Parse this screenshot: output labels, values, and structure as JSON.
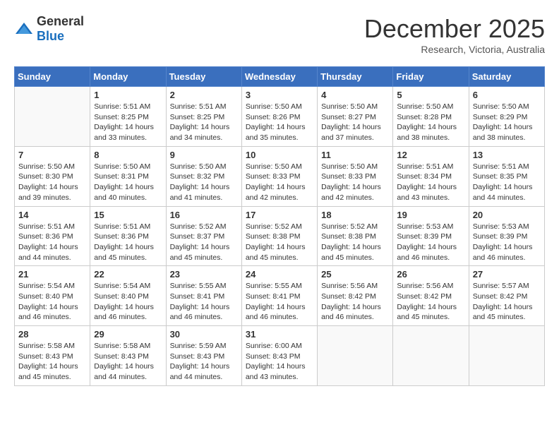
{
  "header": {
    "logo_general": "General",
    "logo_blue": "Blue",
    "month_title": "December 2025",
    "subtitle": "Research, Victoria, Australia"
  },
  "weekdays": [
    "Sunday",
    "Monday",
    "Tuesday",
    "Wednesday",
    "Thursday",
    "Friday",
    "Saturday"
  ],
  "weeks": [
    [
      {
        "day": "",
        "info": ""
      },
      {
        "day": "1",
        "info": "Sunrise: 5:51 AM\nSunset: 8:25 PM\nDaylight: 14 hours\nand 33 minutes."
      },
      {
        "day": "2",
        "info": "Sunrise: 5:51 AM\nSunset: 8:25 PM\nDaylight: 14 hours\nand 34 minutes."
      },
      {
        "day": "3",
        "info": "Sunrise: 5:50 AM\nSunset: 8:26 PM\nDaylight: 14 hours\nand 35 minutes."
      },
      {
        "day": "4",
        "info": "Sunrise: 5:50 AM\nSunset: 8:27 PM\nDaylight: 14 hours\nand 37 minutes."
      },
      {
        "day": "5",
        "info": "Sunrise: 5:50 AM\nSunset: 8:28 PM\nDaylight: 14 hours\nand 38 minutes."
      },
      {
        "day": "6",
        "info": "Sunrise: 5:50 AM\nSunset: 8:29 PM\nDaylight: 14 hours\nand 38 minutes."
      }
    ],
    [
      {
        "day": "7",
        "info": "Sunrise: 5:50 AM\nSunset: 8:30 PM\nDaylight: 14 hours\nand 39 minutes."
      },
      {
        "day": "8",
        "info": "Sunrise: 5:50 AM\nSunset: 8:31 PM\nDaylight: 14 hours\nand 40 minutes."
      },
      {
        "day": "9",
        "info": "Sunrise: 5:50 AM\nSunset: 8:32 PM\nDaylight: 14 hours\nand 41 minutes."
      },
      {
        "day": "10",
        "info": "Sunrise: 5:50 AM\nSunset: 8:33 PM\nDaylight: 14 hours\nand 42 minutes."
      },
      {
        "day": "11",
        "info": "Sunrise: 5:50 AM\nSunset: 8:33 PM\nDaylight: 14 hours\nand 42 minutes."
      },
      {
        "day": "12",
        "info": "Sunrise: 5:51 AM\nSunset: 8:34 PM\nDaylight: 14 hours\nand 43 minutes."
      },
      {
        "day": "13",
        "info": "Sunrise: 5:51 AM\nSunset: 8:35 PM\nDaylight: 14 hours\nand 44 minutes."
      }
    ],
    [
      {
        "day": "14",
        "info": "Sunrise: 5:51 AM\nSunset: 8:36 PM\nDaylight: 14 hours\nand 44 minutes."
      },
      {
        "day": "15",
        "info": "Sunrise: 5:51 AM\nSunset: 8:36 PM\nDaylight: 14 hours\nand 45 minutes."
      },
      {
        "day": "16",
        "info": "Sunrise: 5:52 AM\nSunset: 8:37 PM\nDaylight: 14 hours\nand 45 minutes."
      },
      {
        "day": "17",
        "info": "Sunrise: 5:52 AM\nSunset: 8:38 PM\nDaylight: 14 hours\nand 45 minutes."
      },
      {
        "day": "18",
        "info": "Sunrise: 5:52 AM\nSunset: 8:38 PM\nDaylight: 14 hours\nand 45 minutes."
      },
      {
        "day": "19",
        "info": "Sunrise: 5:53 AM\nSunset: 8:39 PM\nDaylight: 14 hours\nand 46 minutes."
      },
      {
        "day": "20",
        "info": "Sunrise: 5:53 AM\nSunset: 8:39 PM\nDaylight: 14 hours\nand 46 minutes."
      }
    ],
    [
      {
        "day": "21",
        "info": "Sunrise: 5:54 AM\nSunset: 8:40 PM\nDaylight: 14 hours\nand 46 minutes."
      },
      {
        "day": "22",
        "info": "Sunrise: 5:54 AM\nSunset: 8:40 PM\nDaylight: 14 hours\nand 46 minutes."
      },
      {
        "day": "23",
        "info": "Sunrise: 5:55 AM\nSunset: 8:41 PM\nDaylight: 14 hours\nand 46 minutes."
      },
      {
        "day": "24",
        "info": "Sunrise: 5:55 AM\nSunset: 8:41 PM\nDaylight: 14 hours\nand 46 minutes."
      },
      {
        "day": "25",
        "info": "Sunrise: 5:56 AM\nSunset: 8:42 PM\nDaylight: 14 hours\nand 46 minutes."
      },
      {
        "day": "26",
        "info": "Sunrise: 5:56 AM\nSunset: 8:42 PM\nDaylight: 14 hours\nand 45 minutes."
      },
      {
        "day": "27",
        "info": "Sunrise: 5:57 AM\nSunset: 8:42 PM\nDaylight: 14 hours\nand 45 minutes."
      }
    ],
    [
      {
        "day": "28",
        "info": "Sunrise: 5:58 AM\nSunset: 8:43 PM\nDaylight: 14 hours\nand 45 minutes."
      },
      {
        "day": "29",
        "info": "Sunrise: 5:58 AM\nSunset: 8:43 PM\nDaylight: 14 hours\nand 44 minutes."
      },
      {
        "day": "30",
        "info": "Sunrise: 5:59 AM\nSunset: 8:43 PM\nDaylight: 14 hours\nand 44 minutes."
      },
      {
        "day": "31",
        "info": "Sunrise: 6:00 AM\nSunset: 8:43 PM\nDaylight: 14 hours\nand 43 minutes."
      },
      {
        "day": "",
        "info": ""
      },
      {
        "day": "",
        "info": ""
      },
      {
        "day": "",
        "info": ""
      }
    ]
  ]
}
